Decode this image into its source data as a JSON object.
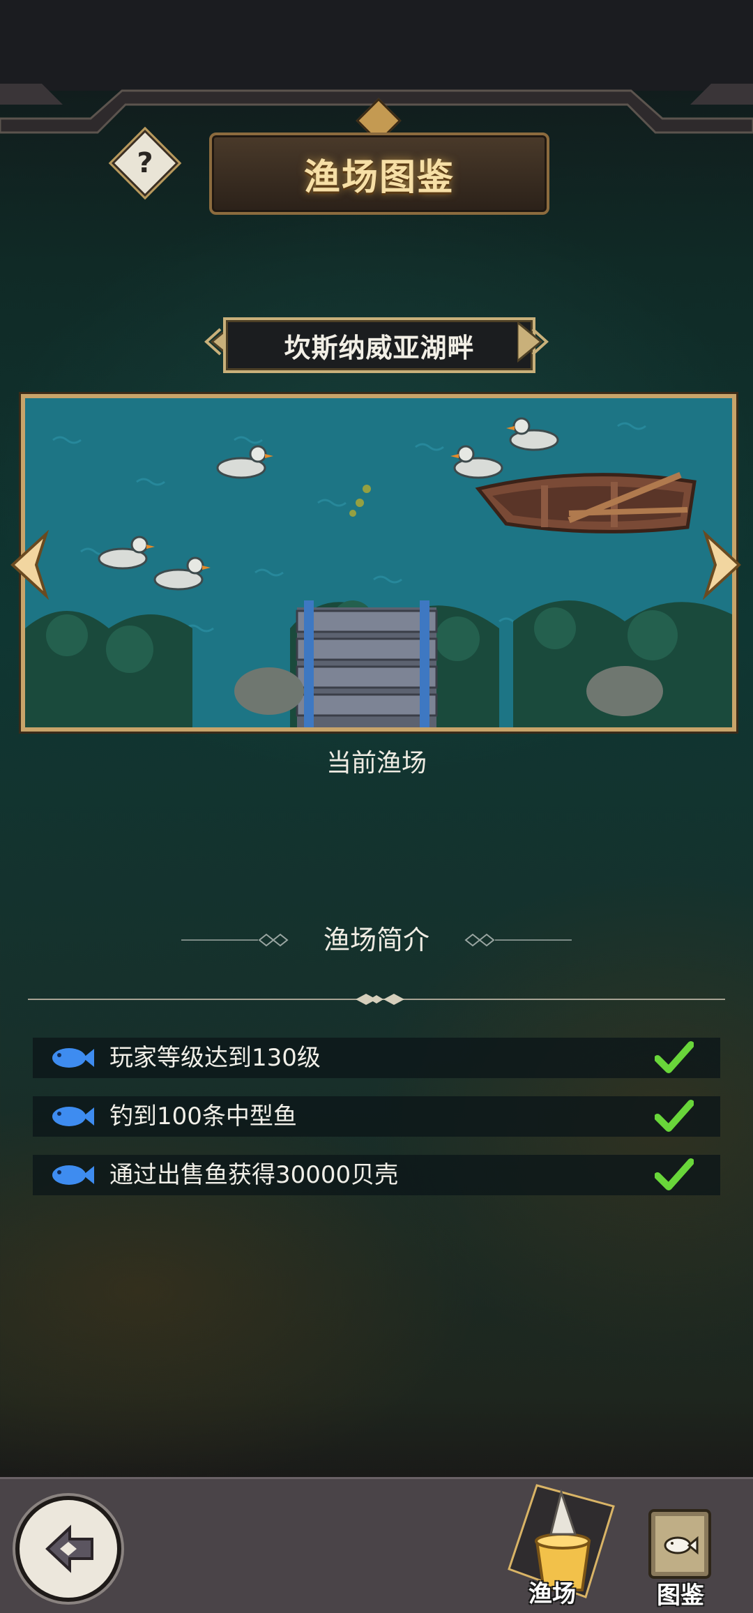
{
  "header": {
    "title": "渔场图鉴",
    "help_icon": "question-icon",
    "help_glyph": "?"
  },
  "location": {
    "name": "坎斯纳威亚湖畔",
    "status_label": "当前渔场"
  },
  "intro": {
    "title": "渔场简介"
  },
  "conditions": [
    {
      "text": "玩家等级达到130级",
      "done": true
    },
    {
      "text": "钓到100条中型鱼",
      "done": true
    },
    {
      "text": "通过出售鱼获得30000贝壳",
      "done": true
    }
  ],
  "bottom_nav": {
    "back_icon": "back-arrow-icon",
    "tabs": [
      {
        "label": "渔场",
        "icon": "bucket-icon",
        "selected": true
      },
      {
        "label": "图鉴",
        "icon": "fish-book-icon",
        "selected": false
      }
    ]
  },
  "colors": {
    "accent_gold": "#c8a46a",
    "check_green": "#69d63a",
    "fish_blue": "#3e8cf0",
    "water": "#1d6f80"
  }
}
